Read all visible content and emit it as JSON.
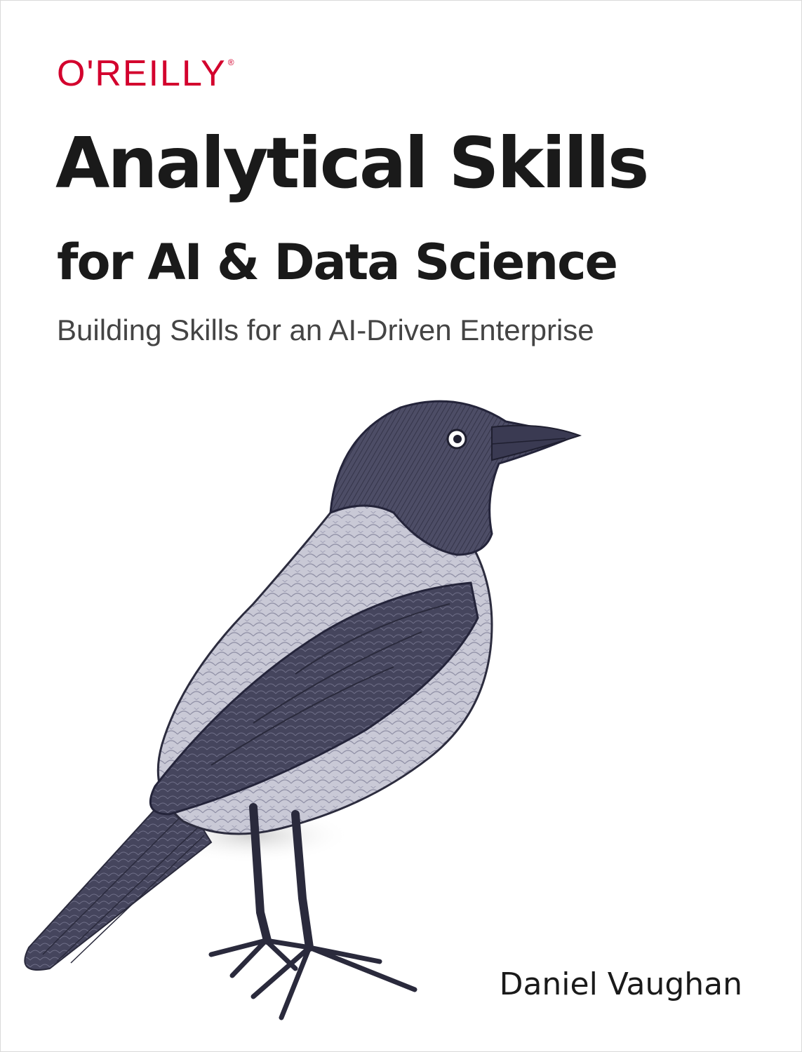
{
  "cover": {
    "publisher": "O'REILLY",
    "publisher_mark": "®",
    "title_line1": "Analytical Skills",
    "title_line2": "for AI & Data Science",
    "subtitle": "Building Skills for an AI-Driven Enterprise",
    "author": "Daniel Vaughan"
  },
  "colors": {
    "brand_red": "#d3002d",
    "title_text": "#1a1a1a",
    "subtitle_text": "#444444"
  },
  "illustration": {
    "icon": "hooded-crow-illustration"
  }
}
